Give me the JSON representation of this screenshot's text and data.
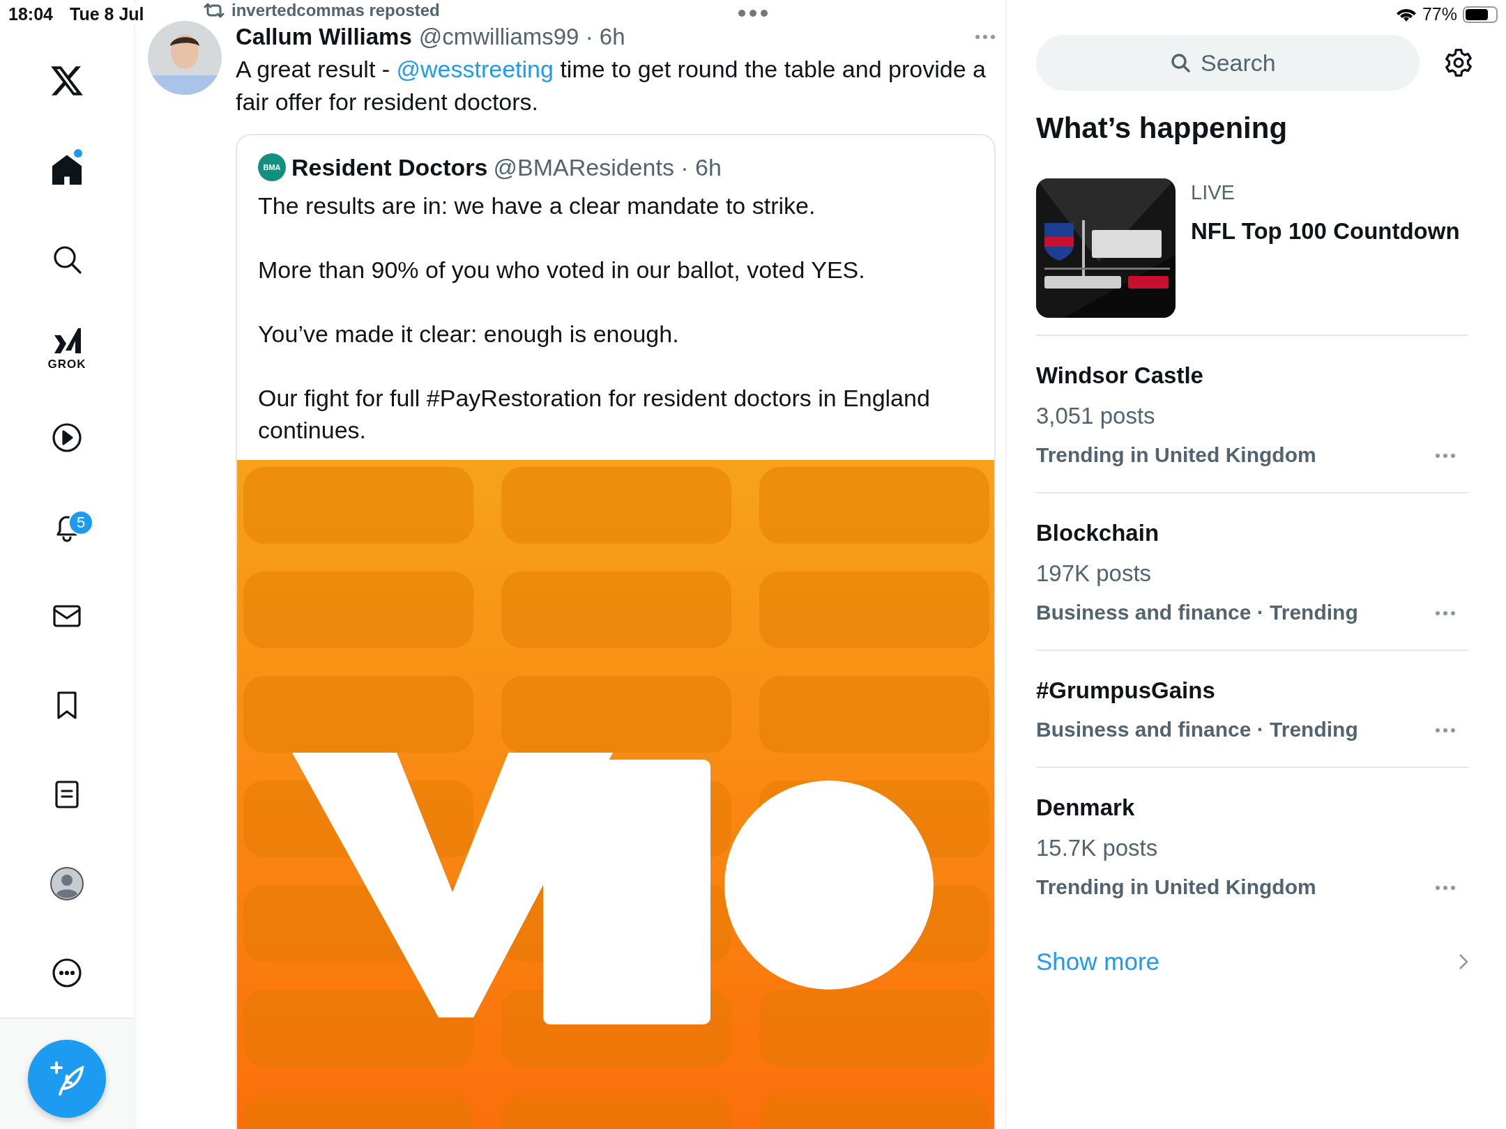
{
  "status_bar": {
    "time": "18:04",
    "date": "Tue 8 Jul",
    "battery": "77%"
  },
  "sidebar": {
    "items": [
      {
        "kind": "logo"
      },
      {
        "kind": "home",
        "selected": true,
        "unread_dot": true
      },
      {
        "kind": "search",
        "selected": false
      },
      {
        "kind": "grok",
        "label": "GROK",
        "selected": false
      },
      {
        "kind": "video",
        "selected": false
      },
      {
        "kind": "notifications",
        "badge": "5",
        "selected": false
      },
      {
        "kind": "messages",
        "selected": false
      },
      {
        "kind": "bookmarks",
        "selected": false
      },
      {
        "kind": "lists",
        "selected": false
      },
      {
        "kind": "profile",
        "selected": false
      },
      {
        "kind": "more",
        "selected": false
      }
    ]
  },
  "post": {
    "reposted_by": "invertedcommas reposted",
    "author": {
      "name": "Callum Williams",
      "byline": "@cmwilliams99 · 6h"
    },
    "text": [
      {
        "kind": "plain",
        "text": "A great result - "
      },
      {
        "kind": "mention",
        "text": "@wesstreeting"
      },
      {
        "kind": "plain",
        "text": " time to get round the table and provide a fair offer for resident doctors."
      }
    ],
    "quote": {
      "author": {
        "name": "Resident Doctors",
        "byline": "@BMAResidents · 6h",
        "avatar_text": "BMA"
      },
      "paragraphs": [
        "The results are in: we have a clear mandate to strike.",
        "More than 90% of you who voted in our ballot, voted YES.",
        "You’ve made it clear: enough is enough.",
        "Our fight for full #PayRestoration for resident doctors in England continues."
      ],
      "media": {
        "kind": "picture"
      }
    }
  },
  "right": {
    "search": {
      "placeholder": "Search"
    },
    "section_title": "What’s happening",
    "trends": [
      {
        "kind": "live",
        "label": "LIVE",
        "title": "NFL Top 100 Countdown"
      },
      {
        "kind": "trend",
        "title": "Windsor Castle",
        "posts": "3,051 posts",
        "context": "Trending in United Kingdom"
      },
      {
        "kind": "trend",
        "title": "Blockchain",
        "posts": "197K posts",
        "context": "Business and finance · Trending"
      },
      {
        "kind": "trend",
        "title": "#GrumpusGains",
        "context": "Business and finance · Trending"
      },
      {
        "kind": "trend",
        "title": "Denmark",
        "posts": "15.7K posts",
        "context": "Trending in United Kingdom"
      }
    ],
    "show_more": "Show more"
  }
}
